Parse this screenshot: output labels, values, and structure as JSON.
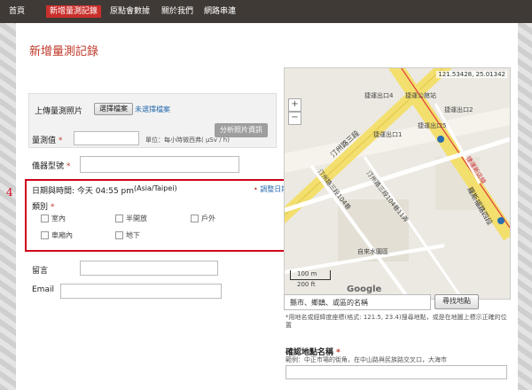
{
  "nav": {
    "items": [
      {
        "label": "首頁"
      },
      {
        "label": "新增量測記錄",
        "active": true
      },
      {
        "label": "原點會數據"
      },
      {
        "label": "關於我們"
      },
      {
        "label": "網路串連"
      }
    ]
  },
  "page": {
    "title": "新增量測記錄"
  },
  "upload": {
    "label": "上傳量測照片",
    "choose_button": "選擇檔案",
    "no_file": "未選擇檔案",
    "analyze_button": "分析照片資訊"
  },
  "measure": {
    "label": "量測值",
    "unit_hint": "單位：每小時微西弗( μSv / h)"
  },
  "device": {
    "label": "儀器型號"
  },
  "datetime": {
    "label": "日期與時間: 今天 04:55 pm",
    "timezone": "(Asia/Taipei)",
    "adjust_link": "調整日期"
  },
  "category": {
    "label": "類別",
    "options": [
      "室內",
      "半開放",
      "戶外",
      "車廂內",
      "地下"
    ]
  },
  "annotation": {
    "step": "4"
  },
  "contact": {
    "nickname_label": "留言",
    "email_label": "Email"
  },
  "map": {
    "coords": "121.53428, 25.01342",
    "zoom_in": "+",
    "zoom_out": "−",
    "scale_m": "100 m",
    "scale_ft": "200 ft",
    "logo": "Google",
    "labels": [
      "捷運出口4",
      "捷運公館站",
      "捷運出口5",
      "捷運出口2",
      "捷運出口1",
      "汀州路三段",
      "汀州路三段104巷",
      "汀州路三段104巷11弄",
      "羅斯福路四段",
      "自來水園區",
      "捷運新店線"
    ]
  },
  "map_search": {
    "placeholder": "縣市、鄉鎮、或區的名稱",
    "button": "尋找地點",
    "hint": "*用地名或經緯度座標(格式: 121.5, 23.4)搜尋地點，或是在地圖上標示正確的位置"
  },
  "place": {
    "label": "確認地點名稱",
    "example": "範例：中正市場的街角，在中山路與民族路交叉口，大海市"
  },
  "colors": {
    "accent": "#c9302c",
    "nav_bg": "#3f3a36",
    "highlight": "#d0021b",
    "road": "#f3df6d"
  }
}
